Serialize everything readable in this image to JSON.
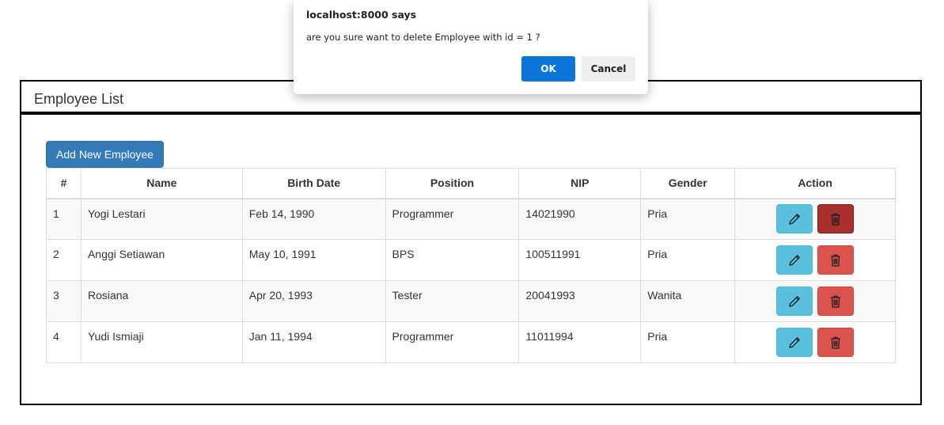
{
  "panel": {
    "title": "Employee List",
    "add_button_label": "Add New Employee"
  },
  "table": {
    "headers": [
      "#",
      "Name",
      "Birth Date",
      "Position",
      "NIP",
      "Gender",
      "Action"
    ],
    "rows": [
      {
        "no": "1",
        "name": "Yogi Lestari",
        "birth_date": "Feb 14, 1990",
        "position": "Programmer",
        "nip": "14021990",
        "gender": "Pria"
      },
      {
        "no": "2",
        "name": "Anggi Setiawan",
        "birth_date": "May 10, 1991",
        "position": "BPS",
        "nip": "100511991",
        "gender": "Pria"
      },
      {
        "no": "3",
        "name": "Rosiana",
        "birth_date": "Apr 20, 1993",
        "position": "Tester",
        "nip": "20041993",
        "gender": "Wanita"
      },
      {
        "no": "4",
        "name": "Yudi Ismiaji",
        "birth_date": "Jan 11, 1994",
        "position": "Programmer",
        "nip": "11011994",
        "gender": "Pria"
      }
    ],
    "action_icons": {
      "edit": "pencil-icon",
      "delete": "trash-icon"
    }
  },
  "dialog": {
    "title": "localhost:8000 says",
    "message": "are you sure want to delete Employee with id = 1 ?",
    "ok_label": "OK",
    "cancel_label": "Cancel"
  },
  "colors": {
    "primary": "#337ab7",
    "info": "#5bc0de",
    "danger": "#d9534f",
    "danger_active": "#a9302d",
    "dialog_ok": "#0b74d8"
  }
}
